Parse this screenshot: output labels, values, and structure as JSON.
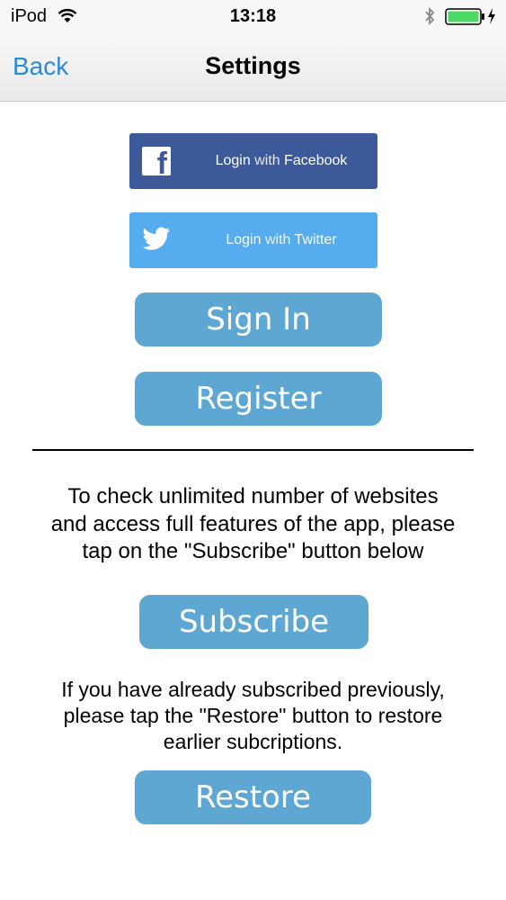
{
  "status_bar": {
    "carrier": "iPod",
    "time": "13:18",
    "battery_color": "#4cd964"
  },
  "nav": {
    "back_label": "Back",
    "title": "Settings",
    "back_color": "#2a8ad8"
  },
  "social": {
    "facebook": {
      "prefix": "Login",
      "connector": "with",
      "provider": "Facebook",
      "icon": "facebook-icon",
      "color": "#3c5a9a"
    },
    "twitter": {
      "prefix": "Login",
      "connector": "with",
      "provider": "Twitter",
      "icon": "twitter-icon",
      "color": "#55acee"
    }
  },
  "buttons": {
    "sign_in": "Sign In",
    "register": "Register",
    "subscribe": "Subscribe",
    "restore": "Restore",
    "color": "#5fa7d3"
  },
  "text": {
    "subscribe_info": "To check unlimited number of websites\nand access full features of the app, please\ntap on the \"Subscribe\" button below",
    "restore_info": "If you have already subscribed previously,\nplease tap the \"Restore\" button to restore\nearlier subcriptions."
  }
}
